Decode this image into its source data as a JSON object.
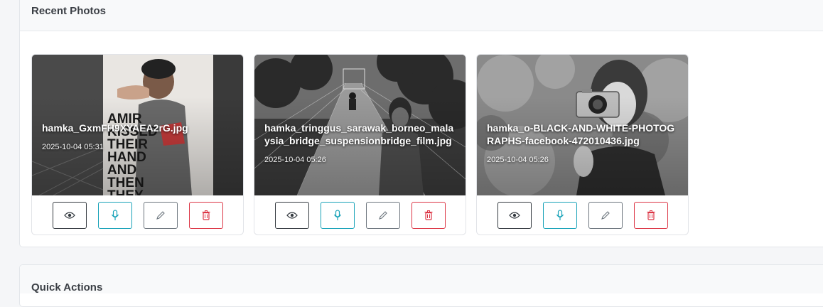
{
  "recent": {
    "title": "Recent Photos"
  },
  "quick": {
    "title": "Quick Actions"
  },
  "colors": {
    "view": "#343a40",
    "audio": "#17a2b8",
    "edit": "#6c757d",
    "delete": "#dc3545"
  },
  "photos": [
    {
      "filename": "hamka_GxmFH9XYAEA2rG.jpg",
      "timestamp": "2025-10-04 05:31",
      "thumb_text": "AMIR KISSED THEIR HAND AND THEN THEY KILLED"
    },
    {
      "filename": "hamka_tringgus_sarawak_borneo_malaysia_bridge_suspensionbridge_film.jpg",
      "timestamp": "2025-10-04 05:26"
    },
    {
      "filename": "hamka_o-BLACK-AND-WHITE-PHOTOGRAPHS-facebook-472010436.jpg",
      "timestamp": "2025-10-04 05:26"
    }
  ],
  "icons": {
    "view": "eye-icon",
    "audio": "microphone-icon",
    "edit": "pencil-icon",
    "delete": "trash-icon"
  }
}
